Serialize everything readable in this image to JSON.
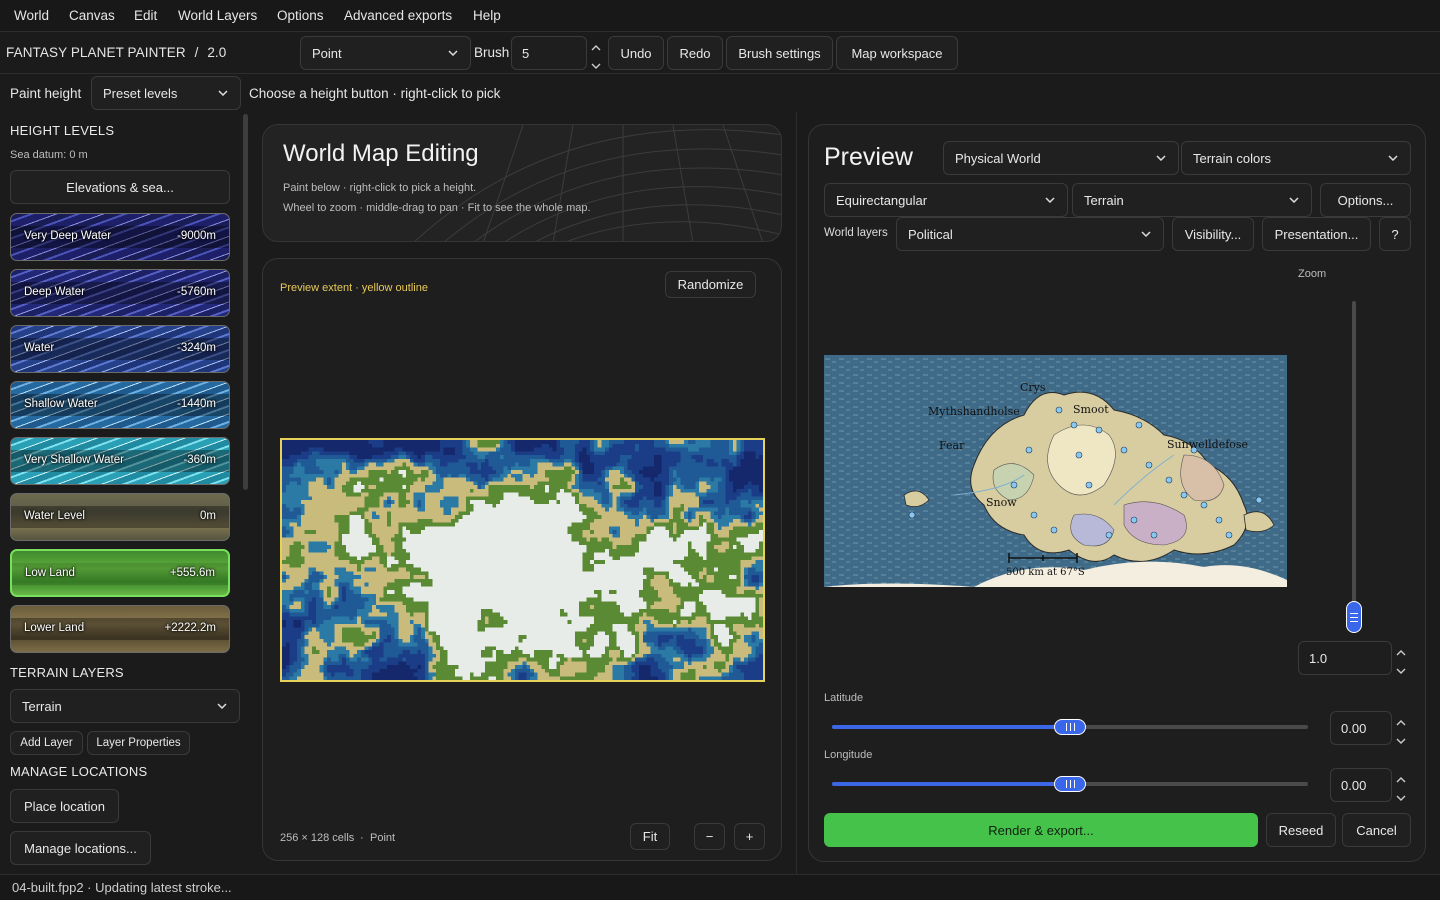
{
  "menu": [
    "World",
    "Canvas",
    "Edit",
    "World Layers",
    "Options",
    "Advanced exports",
    "Help"
  ],
  "toolbar": {
    "app_name": "FANTASY PLANET PAINTER",
    "separator": "/",
    "version": "2.0",
    "tool_value": "Point",
    "brush_label": "Brush",
    "brush_value": "5",
    "undo": "Undo",
    "redo": "Redo",
    "brush_settings": "Brush settings",
    "map_workspace": "Map workspace"
  },
  "paint_row": {
    "label": "Paint height",
    "mode_value": "Preset levels",
    "hint": "Choose a height button · right-click to pick"
  },
  "left": {
    "height_title": "HEIGHT LEVELS",
    "sea_datum": "Sea datum: 0 m",
    "elevations_button": "Elevations & sea...",
    "levels": [
      {
        "name": "Very Deep Water",
        "value": "-9000m"
      },
      {
        "name": "Deep Water",
        "value": "-5760m"
      },
      {
        "name": "Water",
        "value": "-3240m"
      },
      {
        "name": "Shallow Water",
        "value": "-1440m"
      },
      {
        "name": "Very Shallow Water",
        "value": "-360m"
      },
      {
        "name": "Water Level",
        "value": "0m"
      },
      {
        "name": "Low Land",
        "value": "+555.6m"
      },
      {
        "name": "Lower Land",
        "value": "+2222.2m"
      }
    ],
    "selected_level": "Low Land",
    "terrain_title": "TERRAIN LAYERS",
    "terrain_value": "Terrain",
    "add_layer": "Add Layer",
    "layer_properties": "Layer Properties",
    "locations_title": "MANAGE LOCATIONS",
    "place_location": "Place location",
    "manage_locations": "Manage locations..."
  },
  "editor": {
    "title": "World Map Editing",
    "hint1": "Paint below · right-click to pick a height.",
    "hint2": "Wheel to zoom · middle-drag to pan · Fit to see the whole map.",
    "extent_note": "Preview extent · yellow outline",
    "randomize": "Randomize",
    "cells": "256 × 128 cells",
    "dot": "·",
    "tool": "Point",
    "fit": "Fit",
    "zoom_out": "−",
    "zoom_in": "+",
    "grid": {
      "cols": 128,
      "rows": 64
    }
  },
  "preview": {
    "title": "Preview",
    "style_value": "Physical World",
    "colors_value": "Terrain colors",
    "projection_value": "Equirectangular",
    "layer_value": "Terrain",
    "options": "Options...",
    "world_layers_label": "World layers",
    "world_layers_value": "Political",
    "visibility": "Visibility...",
    "presentation": "Presentation...",
    "help": "?",
    "zoom_label": "Zoom",
    "zoom_value": "1.0",
    "zoom_level": 0.0,
    "latitude_label": "Latitude",
    "latitude_value": "0.00",
    "latitude_fraction": 0.5,
    "longitude_label": "Longitude",
    "longitude_value": "0.00",
    "longitude_fraction": 0.5,
    "render": "Render & export...",
    "reseed": "Reseed",
    "cancel": "Cancel",
    "place_labels": [
      "Crys",
      "Mythshandholse",
      "Smoot",
      "Fear",
      "Sunwelldefose",
      "Snow"
    ],
    "scale_label": "500 km at 67°S"
  },
  "colors": {
    "accent_green": "#45c24a",
    "slider_blue": "#3b66e6",
    "extent_yellow": "#e6d25a",
    "selected_outline": "#79e05c"
  },
  "status": "04-built.fpp2 · Updating latest stroke..."
}
